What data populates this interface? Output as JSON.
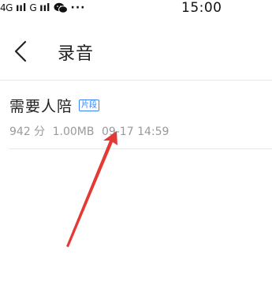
{
  "status_bar": {
    "network_1": "4G",
    "network_2": "G",
    "signal_bars": "ııl",
    "more": "···",
    "time": "15:00"
  },
  "nav": {
    "title": "录音"
  },
  "recording": {
    "title": "需要人陪",
    "tag": "片段",
    "duration": "942 分",
    "size": "1.00MB",
    "datetime": "09-17 14:59"
  },
  "colors": {
    "accent": "#3b82f6",
    "meta_text": "#9a9a9a",
    "annotation": "#e53935"
  }
}
